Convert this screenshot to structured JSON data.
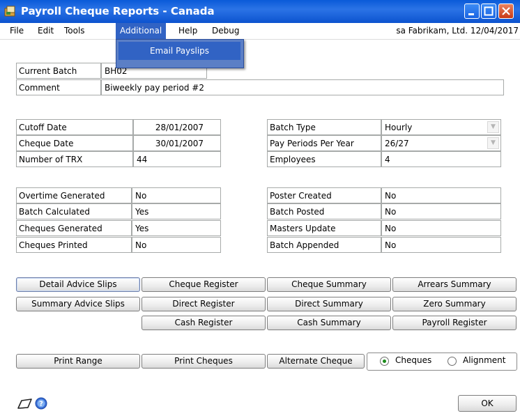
{
  "window": {
    "title": "Payroll Cheque Reports  - Canada"
  },
  "menu": {
    "items": [
      "File",
      "Edit",
      "Tools",
      "Additional",
      "Help",
      "Debug"
    ],
    "info": "sa  Fabrikam, Ltd.  12/04/2017",
    "dropdown": {
      "items": [
        "Email Payslips"
      ]
    }
  },
  "batch": {
    "current_batch_label": "Current Batch",
    "current_batch_value": "BH02",
    "comment_label": "Comment",
    "comment_value": "Biweekly pay period #2"
  },
  "dates": {
    "cutoff_date_label": "Cutoff Date",
    "cutoff_date_value": "28/01/2007",
    "cheque_date_label": "Cheque Date",
    "cheque_date_value": "30/01/2007",
    "number_trx_label": "Number of TRX",
    "number_trx_value": "44",
    "batch_type_label": "Batch Type",
    "batch_type_value": "Hourly",
    "pay_periods_label": "Pay Periods Per Year",
    "pay_periods_value": "26/27",
    "employees_label": "Employees",
    "employees_value": "4"
  },
  "status": {
    "overtime_generated_label": "Overtime Generated",
    "overtime_generated_value": "No",
    "batch_calculated_label": "Batch Calculated",
    "batch_calculated_value": "Yes",
    "cheques_generated_label": "Cheques Generated",
    "cheques_generated_value": "Yes",
    "cheques_printed_label": "Cheques Printed",
    "cheques_printed_value": "No",
    "poster_created_label": "Poster Created",
    "poster_created_value": "No",
    "batch_posted_label": "Batch Posted",
    "batch_posted_value": "No",
    "masters_update_label": "Masters Update",
    "masters_update_value": "No",
    "batch_appended_label": "Batch Appended",
    "batch_appended_value": "No"
  },
  "buttons": {
    "detail_advice_slips": "Detail Advice Slips",
    "cheque_register": "Cheque Register",
    "cheque_summary": "Cheque Summary",
    "arrears_summary": "Arrears Summary",
    "summary_advice_slips": "Summary Advice Slips",
    "direct_register": "Direct Register",
    "direct_summary": "Direct Summary",
    "zero_summary": "Zero Summary",
    "cash_register": "Cash Register",
    "cash_summary": "Cash Summary",
    "payroll_register": "Payroll Register",
    "print_range": "Print Range",
    "print_cheques": "Print Cheques",
    "alternate_cheque": "Alternate Cheque",
    "ok": "OK"
  },
  "print_mode": {
    "options": [
      "Cheques",
      "Alignment"
    ],
    "selected": "Cheques"
  },
  "colors": {
    "title_bar": "#0c5ad9",
    "menu_highlight": "#3163c4",
    "radio_selected": "#1c8c1c"
  }
}
